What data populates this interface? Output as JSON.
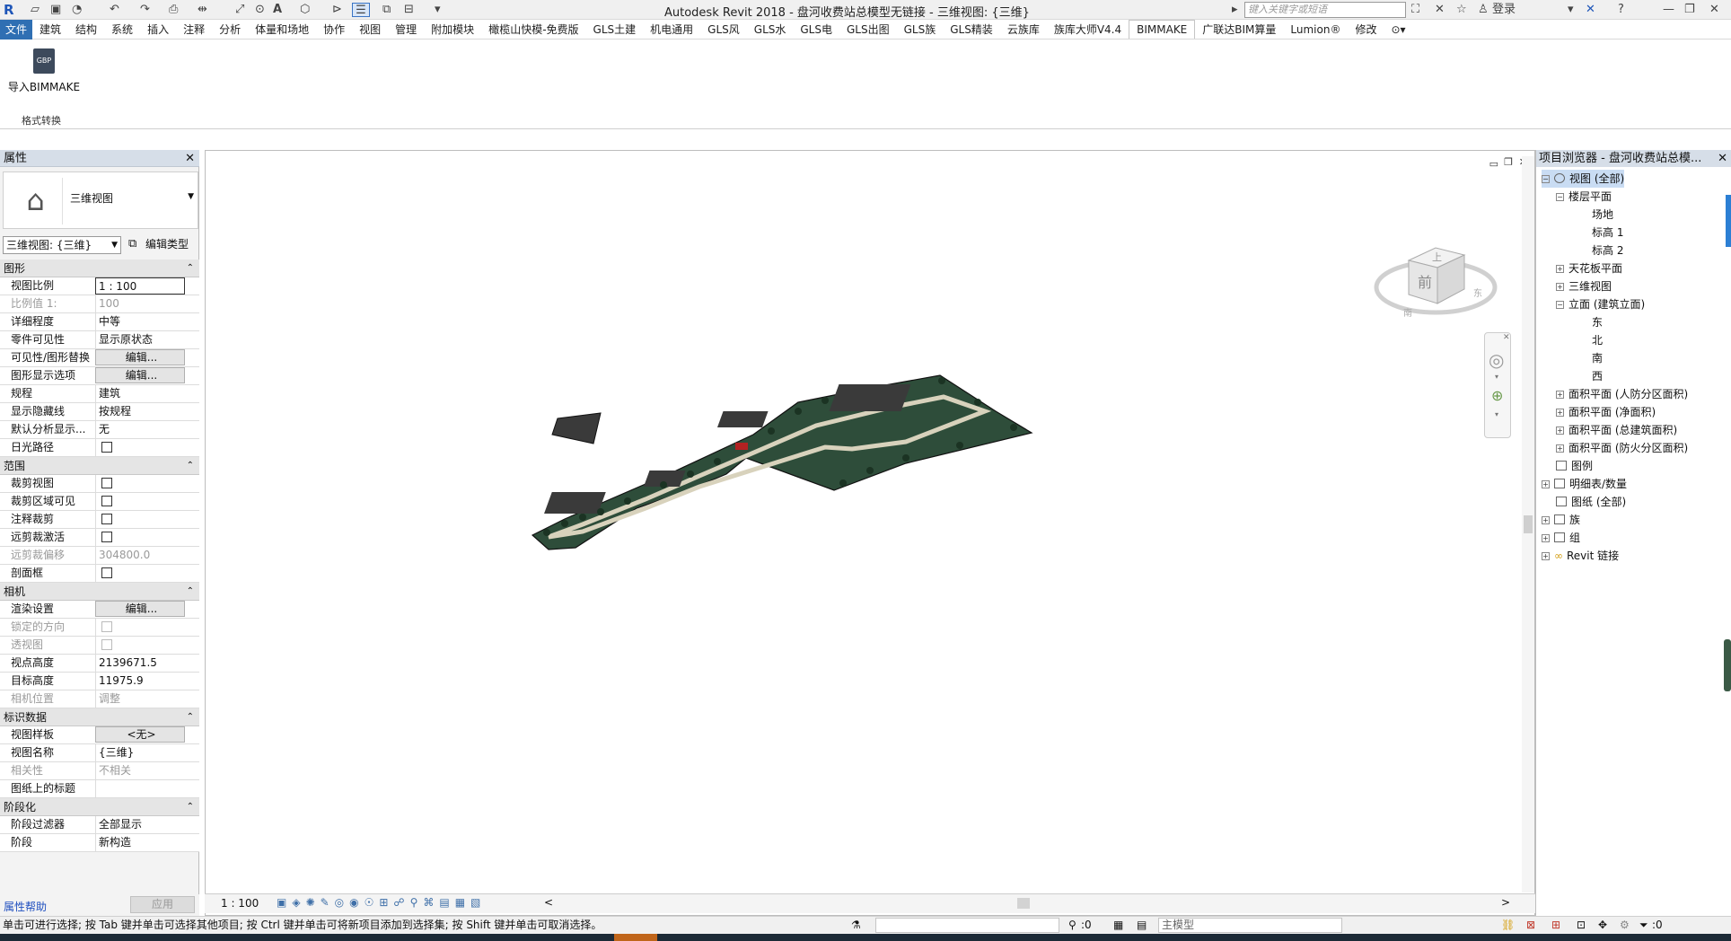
{
  "app": {
    "title": "Autodesk Revit 2018 -     盘河收费站总模型无链接 - 三维视图: {三维}",
    "search_placeholder": "键入关键字或短语",
    "login": "登录"
  },
  "tabs": [
    "文件",
    "建筑",
    "结构",
    "系统",
    "插入",
    "注释",
    "分析",
    "体量和场地",
    "协作",
    "视图",
    "管理",
    "附加模块",
    "橄榄山快模-免费版",
    "GLS土建",
    "机电通用",
    "GLS风",
    "GLS水",
    "GLS电",
    "GLS出图",
    "GLS族",
    "GLS精装",
    "云族库",
    "族库大师V4.4",
    "BIMMAKE",
    "广联达BIM算量",
    "Lumion®",
    "修改"
  ],
  "ribbon": {
    "import_label": "导入BIMMAKE",
    "import_icon_text": "GBP",
    "panel_label": "格式转换"
  },
  "properties": {
    "title": "属性",
    "type_name": "三维视图",
    "view_dropdown": "三维视图: {三维}",
    "edit_type": "编辑类型",
    "sections": {
      "graphics": "图形",
      "extents": "范围",
      "camera": "相机",
      "identity": "标识数据",
      "phasing": "阶段化"
    },
    "rows": {
      "view_scale": [
        "视图比例",
        "1 : 100"
      ],
      "scale_value": [
        "比例值 1:",
        "100"
      ],
      "detail_level": [
        "详细程度",
        "中等"
      ],
      "parts_visibility": [
        "零件可见性",
        "显示原状态"
      ],
      "vg_overrides": [
        "可见性/图形替换",
        "编辑..."
      ],
      "graphic_display": [
        "图形显示选项",
        "编辑..."
      ],
      "discipline": [
        "规程",
        "建筑"
      ],
      "hidden_lines": [
        "显示隐藏线",
        "按规程"
      ],
      "analysis_display": [
        "默认分析显示...",
        "无"
      ],
      "sun_path": [
        "日光路径",
        ""
      ],
      "crop_view": [
        "裁剪视图",
        ""
      ],
      "crop_visible": [
        "裁剪区域可见",
        ""
      ],
      "annotation_crop": [
        "注释裁剪",
        ""
      ],
      "far_clip_active": [
        "远剪裁激活",
        ""
      ],
      "far_clip_offset": [
        "远剪裁偏移",
        "304800.0"
      ],
      "section_box": [
        "剖面框",
        ""
      ],
      "render_settings": [
        "渲染设置",
        "编辑..."
      ],
      "locked_orientation": [
        "锁定的方向",
        ""
      ],
      "perspective": [
        "透视图",
        ""
      ],
      "eye_elevation": [
        "视点高度",
        "2139671.5"
      ],
      "target_elevation": [
        "目标高度",
        "11975.9"
      ],
      "camera_position": [
        "相机位置",
        "调整"
      ],
      "view_template": [
        "视图样板",
        "<无>"
      ],
      "view_name": [
        "视图名称",
        "{三维}"
      ],
      "dependency": [
        "相关性",
        "不相关"
      ],
      "title_on_sheet": [
        "图纸上的标题",
        ""
      ],
      "phase_filter": [
        "阶段过滤器",
        "全部显示"
      ],
      "phase": [
        "阶段",
        "新构造"
      ]
    },
    "help_link": "属性帮助",
    "apply": "应用"
  },
  "viewbar": {
    "scale": "1 : 100"
  },
  "viewcube": {
    "front": "前",
    "top": "上",
    "right": "东",
    "south": "南"
  },
  "browser": {
    "title": "项目浏览器 - 盘河收费站总模...",
    "items": {
      "views": "视图 (全部)",
      "floor_plans": "楼层平面",
      "site": "场地",
      "level1": "标高 1",
      "level2": "标高 2",
      "ceiling_plans": "天花板平面",
      "views_3d": "三维视图",
      "elevations": "立面 (建筑立面)",
      "east": "东",
      "north": "北",
      "south": "南",
      "west": "西",
      "area_civil": "面积平面 (人防分区面积)",
      "area_net": "面积平面 (净面积)",
      "area_gross": "面积平面 (总建筑面积)",
      "area_fire": "面积平面 (防火分区面积)",
      "legends": "图例",
      "schedules": "明细表/数量",
      "sheets": "图纸 (全部)",
      "families": "族",
      "groups": "组",
      "links": "Revit 链接"
    }
  },
  "status": {
    "text": "单击可进行选择; 按 Tab 键并单击可选择其他项目; 按 Ctrl 键并单击可将新项目添加到选择集; 按 Shift 键并单击可取消选择。",
    "count": ":0",
    "model": "主模型",
    "filter_count": ":0"
  },
  "colors": {
    "site_green": "#2e4d3a",
    "road": "#d8d2bc",
    "tree": "#1b3323",
    "building": "#3a3a3a"
  }
}
